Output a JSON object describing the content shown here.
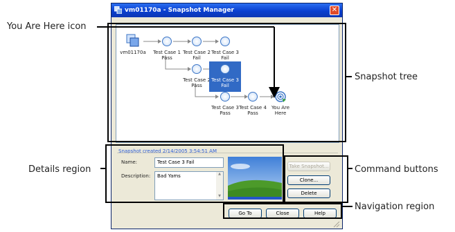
{
  "window": {
    "title": "vm01170a - Snapshot Manager",
    "close_glyph": "✕"
  },
  "tree": {
    "root_label": "vm01170a",
    "row1": [
      {
        "line1": "Test Case 1",
        "line2": "Pass"
      },
      {
        "line1": "Test Case 2",
        "line2": "Fail"
      },
      {
        "line1": "Test Case 3",
        "line2": "Fail"
      }
    ],
    "row2": [
      {
        "line1": "Test Case 2",
        "line2": "Pass"
      },
      {
        "line1": "Test Case 3",
        "line2": "Fail"
      }
    ],
    "row3": [
      {
        "line1": "Test Case 3",
        "line2": "Pass"
      },
      {
        "line1": "Test Case 4",
        "line2": "Pass"
      },
      {
        "line1": "You Are",
        "line2": "Here"
      }
    ]
  },
  "details": {
    "created": "Snapshot created 2/14/2005 3:54:51 AM",
    "name_label": "Name:",
    "name_value": "Test Case 3 Fail",
    "description_label": "Description:",
    "description_value": "Bad Yams"
  },
  "commands": {
    "take_snapshot": "Take Snapshot...",
    "clone": "Clone...",
    "delete": "Delete"
  },
  "navigation": {
    "go_to": "Go To",
    "close": "Close",
    "help": "Help"
  },
  "callouts": {
    "you_are_here_icon": "You Are Here icon",
    "snapshot_tree": "Snapshot tree",
    "details_region": "Details region",
    "command_buttons": "Command buttons",
    "navigation_region": "Navigation region"
  },
  "colors": {
    "titlebar": "#0a3fd0",
    "selection": "#316ac5",
    "link_blue": "#2a5bd7"
  }
}
